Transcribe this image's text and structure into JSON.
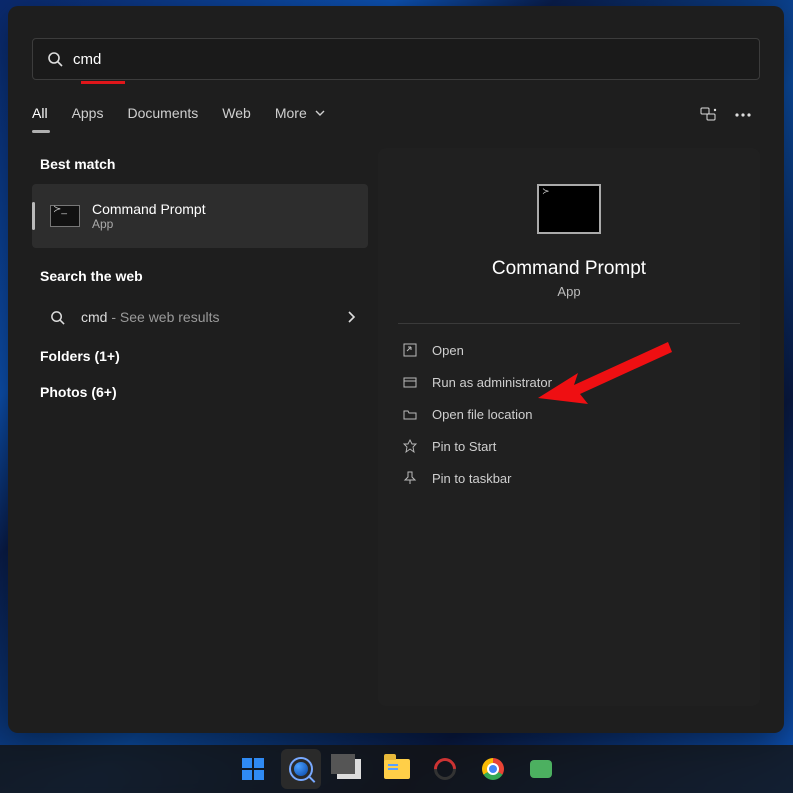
{
  "search": {
    "value": "cmd"
  },
  "tabs": {
    "items": [
      "All",
      "Apps",
      "Documents",
      "Web",
      "More"
    ],
    "active": 0
  },
  "left": {
    "best_match_label": "Best match",
    "result": {
      "title": "Command Prompt",
      "subtitle": "App"
    },
    "search_web_label": "Search the web",
    "web": {
      "term": "cmd",
      "hint": " - See web results"
    },
    "folders_label": "Folders (1+)",
    "photos_label": "Photos (6+)"
  },
  "right": {
    "title": "Command Prompt",
    "subtitle": "App",
    "actions": [
      "Open",
      "Run as administrator",
      "Open file location",
      "Pin to Start",
      "Pin to taskbar"
    ]
  },
  "annotation": {
    "arrow_points_to": "Run as administrator"
  }
}
